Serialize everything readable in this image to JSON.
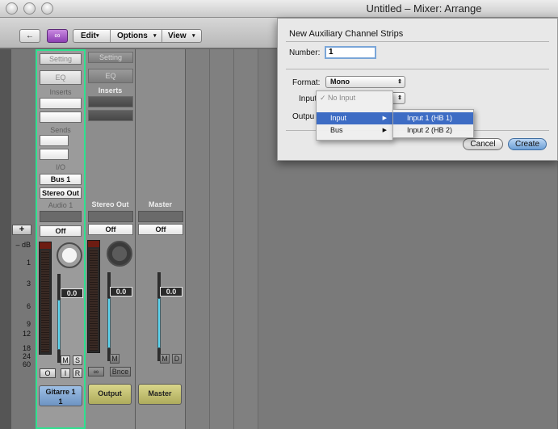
{
  "window": {
    "title": "Untitled – Mixer: Arrange"
  },
  "toolbar": {
    "back_glyph": "←",
    "link_glyph": "∞",
    "menus": [
      "Edit",
      "Options",
      "View"
    ]
  },
  "mixer": {
    "add_button": "+",
    "db_label": "– dB",
    "db_ticks": [
      "1",
      "3",
      "6",
      "9",
      "12",
      "18",
      "24",
      "60"
    ],
    "strips": [
      {
        "setting": "Setting",
        "eq": "EQ",
        "inserts": "Inserts",
        "sends": "Sends",
        "io": "I/O",
        "input": "Bus 1",
        "output": "Stereo Out",
        "group_name": "Audio 1",
        "automation": "Off",
        "fader_value": "0.0",
        "buttons_ms": [
          "M",
          "S"
        ],
        "buttons_oir": [
          "O",
          "I",
          "R"
        ],
        "name_line1": "Gitarre 1",
        "name_line2": "1"
      },
      {
        "setting": "Setting",
        "eq": "EQ",
        "inserts": "Inserts",
        "group_name": "Stereo Out",
        "automation": "Off",
        "fader_value": "0.0",
        "buttons_m": "M",
        "link_glyph": "∞",
        "bounce": "Bnce",
        "name_line1": "Output"
      },
      {
        "group_name": "Master",
        "automation": "Off",
        "fader_value": "0.0",
        "buttons_md": [
          "M",
          "D"
        ],
        "name_line1": "Master"
      }
    ]
  },
  "dialog": {
    "title": "New Auxiliary Channel Strips",
    "number_label": "Number:",
    "number_value": "1",
    "format_label": "Format:",
    "format_value": "Mono",
    "input_label": "Input",
    "output_label": "Outpu",
    "cancel_button": "Cancel",
    "create_button": "Create"
  },
  "input_menu": {
    "checked_item": "✓ No Input",
    "items": [
      "Input",
      "Bus"
    ]
  },
  "submenu": {
    "items": [
      "Input 1  (HB 1)",
      "Input 2  (HB 2)"
    ]
  },
  "colors": {
    "selection": "#2fe08f",
    "fader": "#5fd6f0",
    "menu_highlight": "#3d6cc4",
    "name_blue": "#8fb3dd",
    "name_olive": "#c9c67a"
  }
}
